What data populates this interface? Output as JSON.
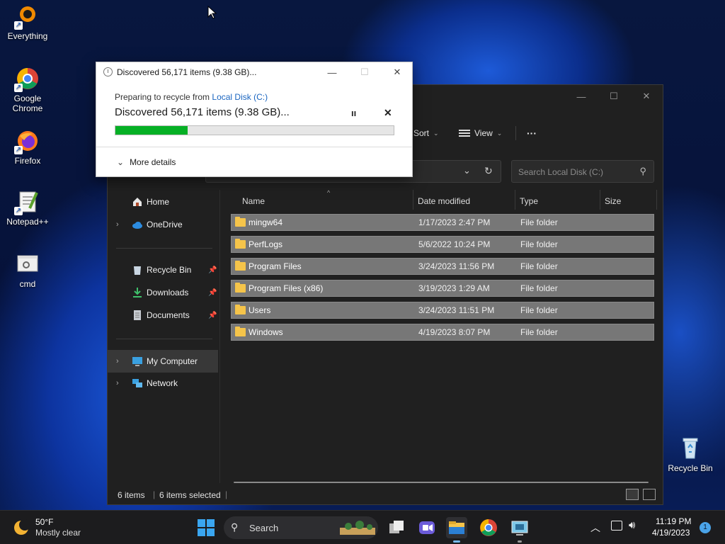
{
  "desktop": {
    "icons": [
      {
        "label": "Everything",
        "icon": "everything-icon"
      },
      {
        "label": "Google Chrome",
        "icon": "chrome-icon"
      },
      {
        "label": "Firefox",
        "icon": "firefox-icon"
      },
      {
        "label": "Notepad++",
        "icon": "notepad-plus-plus-icon"
      },
      {
        "label": "cmd",
        "icon": "cmd-icon"
      },
      {
        "label": "Recycle Bin",
        "icon": "recycle-bin-icon"
      }
    ]
  },
  "explorer": {
    "toolbar": {
      "sort": "Sort",
      "view": "View",
      "more": "···"
    },
    "search_placeholder": "Search Local Disk (C:)",
    "nav": {
      "home": "Home",
      "onedrive": "OneDrive",
      "recycle_bin": "Recycle Bin",
      "downloads": "Downloads",
      "documents": "Documents",
      "my_computer": "My Computer",
      "network": "Network"
    },
    "columns": {
      "name": "Name",
      "date": "Date modified",
      "type": "Type",
      "size": "Size"
    },
    "rows": [
      {
        "name": "mingw64",
        "date": "1/17/2023 2:47 PM",
        "type": "File folder"
      },
      {
        "name": "PerfLogs",
        "date": "5/6/2022 10:24 PM",
        "type": "File folder"
      },
      {
        "name": "Program Files",
        "date": "3/24/2023 11:56 PM",
        "type": "File folder"
      },
      {
        "name": "Program Files (x86)",
        "date": "3/19/2023 1:29 AM",
        "type": "File folder"
      },
      {
        "name": "Users",
        "date": "3/24/2023 11:51 PM",
        "type": "File folder"
      },
      {
        "name": "Windows",
        "date": "4/19/2023 8:07 PM",
        "type": "File folder"
      }
    ],
    "status": {
      "items": "6 items",
      "selected": "6 items selected"
    }
  },
  "dialog": {
    "title": "Discovered 56,171 items (9.38 GB)...",
    "from_prefix": "Preparing to recycle from ",
    "from_link": "Local Disk (C:)",
    "headline": "Discovered 56,171 items (9.38 GB)...",
    "progress": 0.26,
    "more_details": "More details"
  },
  "taskbar": {
    "weather_temp": "50°F",
    "weather_desc": "Mostly clear",
    "search": "Search",
    "time": "11:19 PM",
    "date": "4/19/2023",
    "notification_count": "1"
  },
  "colors": {
    "progress": "#06b025",
    "link": "#1a65c0",
    "selection": "#777777"
  }
}
